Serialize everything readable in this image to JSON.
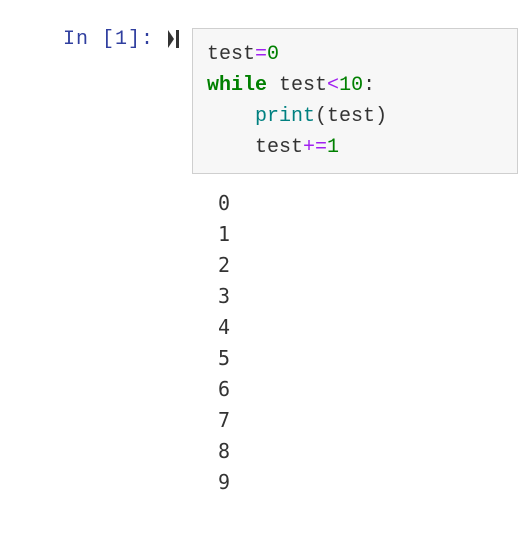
{
  "cell": {
    "prompt_prefix": "In ",
    "prompt_number_open": "[",
    "prompt_number": "1",
    "prompt_number_close": "]:",
    "code": {
      "line1": {
        "var": "test",
        "op": "=",
        "val": "0"
      },
      "line2": {
        "kw": "while",
        "sp": " ",
        "var": "test",
        "op": "<",
        "val": "10",
        "colon": ":"
      },
      "line3": {
        "indent": "    ",
        "fn": "print",
        "open": "(",
        "arg": "test",
        "close": ")"
      },
      "line4": {
        "indent": "    ",
        "var": "test",
        "op": "+=",
        "val": "1"
      }
    }
  },
  "output": {
    "lines": [
      "0",
      "1",
      "2",
      "3",
      "4",
      "5",
      "6",
      "7",
      "8",
      "9"
    ]
  },
  "icons": {
    "run": "run-cell-icon"
  }
}
